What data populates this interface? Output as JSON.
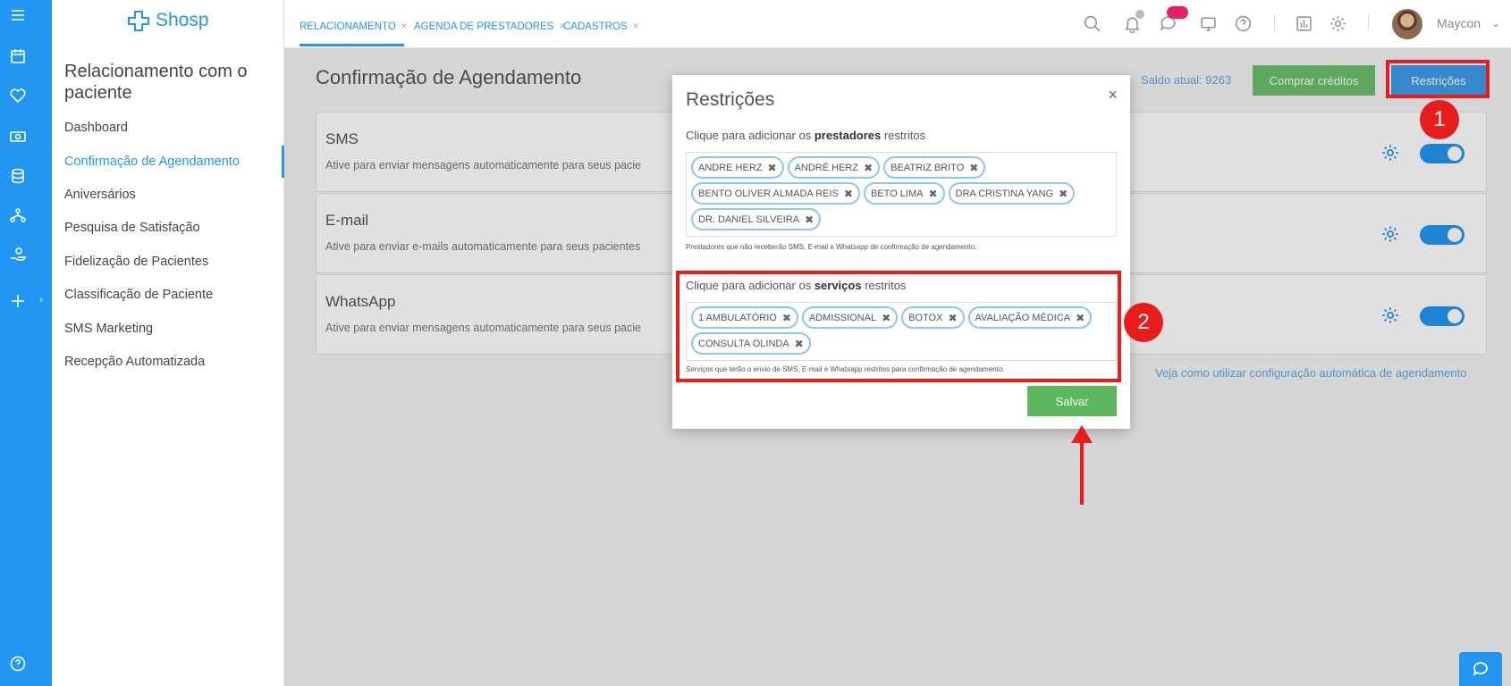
{
  "app": {
    "name": "Shosp",
    "brand_color": "#2196f3"
  },
  "rail": {
    "icons": [
      "menu-icon",
      "calendar-icon",
      "heart-icon",
      "money-icon",
      "database-icon",
      "network-icon",
      "hand-user-icon",
      "plus-icon",
      "help-icon"
    ]
  },
  "subnav": {
    "title": "Relacionamento com o paciente",
    "items": [
      {
        "label": "Dashboard"
      },
      {
        "label": "Confirmação de Agendamento"
      },
      {
        "label": "Aniversários"
      },
      {
        "label": "Pesquisa de Satisfação"
      },
      {
        "label": "Fidelização de Pacientes"
      },
      {
        "label": "Classificação de Paciente"
      },
      {
        "label": "SMS Marketing"
      },
      {
        "label": "Recepção Automatizada"
      }
    ]
  },
  "topbar": {
    "tabs": [
      {
        "label": "RELACIONAMENTO"
      },
      {
        "label": "AGENDA DE PRESTADORES"
      },
      {
        "label": "CADASTROS"
      }
    ],
    "close_glyph": "×",
    "user": "Maycon"
  },
  "main": {
    "page_title": "Confirmação de Agendamento",
    "saldo": "Saldo atual: 9263",
    "buy_label": "Comprar créditos",
    "restrictions_label": "Restrições",
    "cards": [
      {
        "title": "SMS",
        "desc": "Ative para enviar mensagens automaticamente para seus pacie"
      },
      {
        "title": "E-mail",
        "desc": "Ative para enviar e-mails automaticamente para seus pacientes"
      },
      {
        "title": "WhatsApp",
        "desc": "Ative para enviar mensagens automaticamente para seus pacie"
      }
    ],
    "help_link": "Veja como utilizar configuração automática de agendamento"
  },
  "modal": {
    "title": "Restrições",
    "close": "×",
    "providers": {
      "label_pre": "Clique para adicionar os ",
      "label_bold": "prestadores",
      "label_post": " restritos",
      "tags": [
        "ANDRE HERZ",
        "ANDRÉ HERZ",
        "BEATRIZ BRITO",
        "BENTO OLIVER ALMADA REIS",
        "BETO LIMA",
        "DRA CRISTINA YANG",
        "DR. DANIEL SILVEIRA"
      ],
      "hint": "Prestadores que não receberão SMS, E-mail e Whatsapp de confirmação de agendamento."
    },
    "services": {
      "label_pre": "Clique para adicionar os ",
      "label_bold": "serviços",
      "label_post": " restritos",
      "tags": [
        "1 AMBULATÓRIO",
        "ADMISSIONAL",
        "BOTOX",
        "AVALIAÇÃO MÉDICA",
        "CONSULTA OLINDA"
      ],
      "hint": "Serviços que terão o envio de SMS, E-mail e Whatsapp restritos para confirmação de agendamento."
    },
    "save_label": "Salvar"
  },
  "annotations": {
    "step1": "1",
    "step2": "2",
    "color": "#e81c1c"
  }
}
